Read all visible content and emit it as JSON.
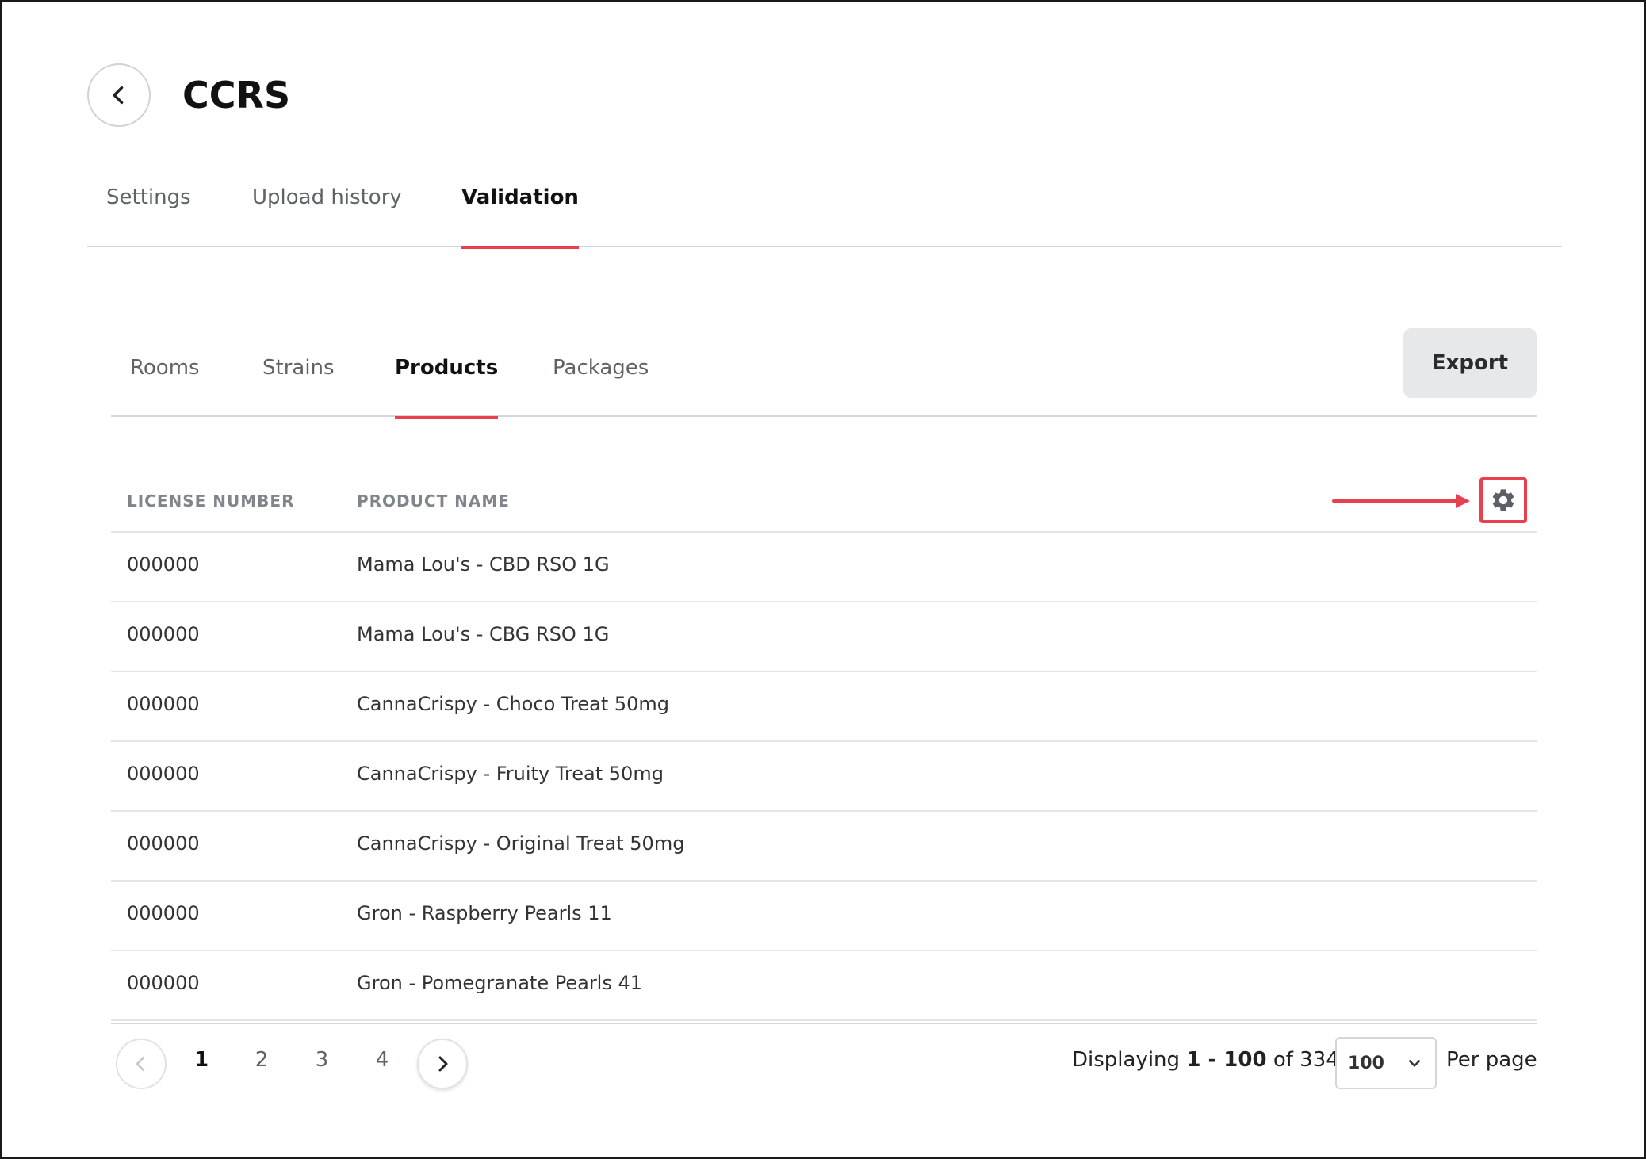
{
  "header": {
    "title": "CCRS",
    "back_icon": "chevron-left-icon"
  },
  "main_tabs": [
    {
      "label": "Settings",
      "active": false
    },
    {
      "label": "Upload history",
      "active": false
    },
    {
      "label": "Validation",
      "active": true
    }
  ],
  "sub_tabs": [
    {
      "label": "Rooms",
      "active": false
    },
    {
      "label": "Strains",
      "active": false
    },
    {
      "label": "Products",
      "active": true
    },
    {
      "label": "Packages",
      "active": false
    }
  ],
  "toolbar": {
    "export_label": "Export",
    "settings_icon": "gear-icon"
  },
  "table": {
    "columns": [
      "LICENSE NUMBER",
      "PRODUCT NAME"
    ],
    "rows": [
      [
        "000000",
        "Mama Lou's - CBD RSO 1G"
      ],
      [
        "000000",
        "Mama Lou's - CBG RSO 1G"
      ],
      [
        "000000",
        "CannaCrispy - Choco Treat 50mg"
      ],
      [
        "000000",
        "CannaCrispy - Fruity Treat 50mg"
      ],
      [
        "000000",
        "CannaCrispy - Original Treat 50mg"
      ],
      [
        "000000",
        "Gron - Raspberry Pearls 11"
      ],
      [
        "000000",
        "Gron - Pomegranate Pearls 41"
      ]
    ]
  },
  "pagination": {
    "pages": [
      "1",
      "2",
      "3",
      "4"
    ],
    "current_page": "1",
    "displaying_prefix": "Displaying",
    "range": "1 - 100",
    "of_label": "of",
    "total": "334",
    "per_page_value": "100",
    "per_page_label": "Per page"
  },
  "colors": {
    "accent": "#e8404f",
    "export_bg": "#e6e8ea",
    "divider": "#d4d6d9"
  }
}
